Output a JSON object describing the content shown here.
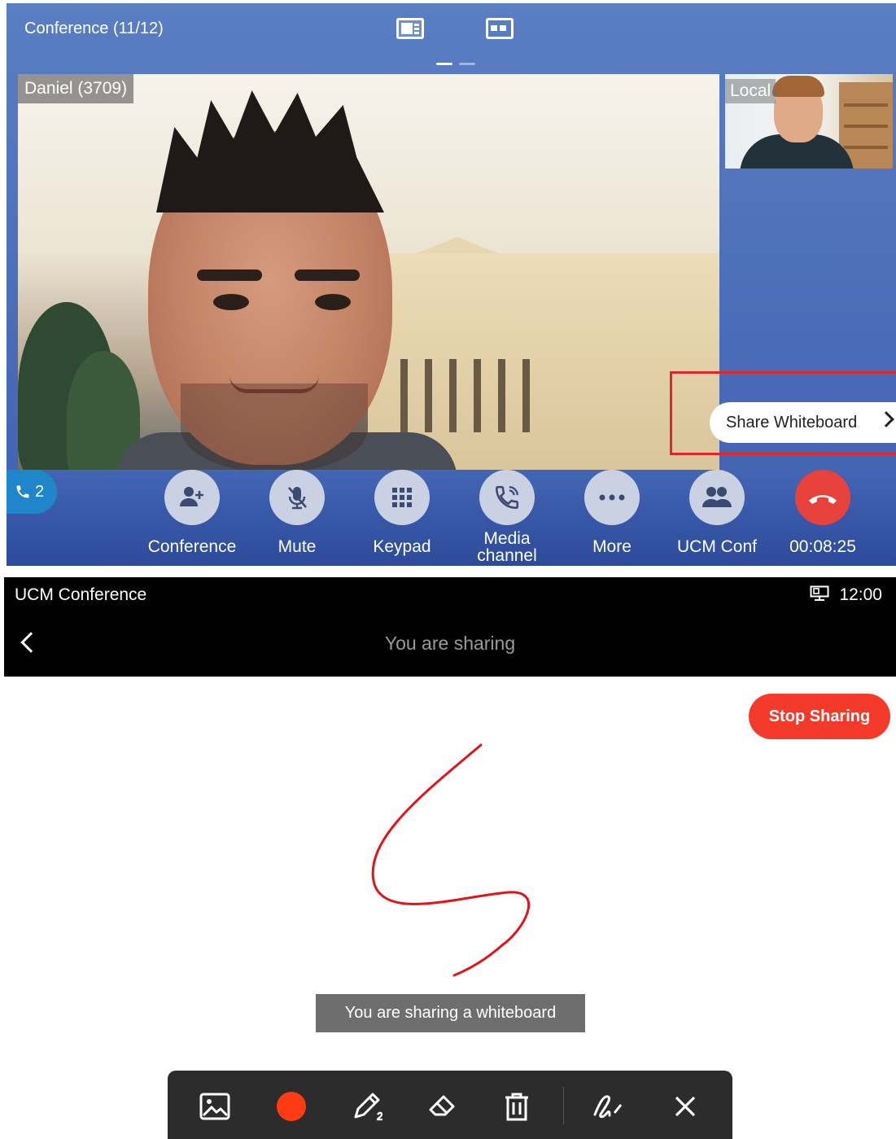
{
  "call": {
    "title": "Conference (11/12)",
    "remote_name": "Daniel (3709)",
    "local_label": "Local",
    "share_whiteboard_label": "Share Whiteboard",
    "active_calls": "2",
    "controls": [
      {
        "label": "Conference",
        "icon": "add-user-icon"
      },
      {
        "label": "Mute",
        "icon": "microphone-muted-icon"
      },
      {
        "label": "Keypad",
        "icon": "keypad-icon"
      },
      {
        "label_line1": "Media",
        "label_line2": "channel",
        "icon": "media-channel-icon"
      },
      {
        "label": "More",
        "icon": "more-icon"
      },
      {
        "label": "UCM Conf",
        "icon": "group-icon"
      },
      {
        "label": "00:08:25",
        "icon": "hang-up-icon"
      }
    ],
    "colors": {
      "accent": "#4a6cb8",
      "hangup": "#e8423d",
      "highlight": "#e0262b"
    }
  },
  "whiteboard": {
    "app_name": "UCM Conference",
    "time": "12:00",
    "header_title": "You are sharing",
    "stop_label": "Stop Sharing",
    "toast": "You are sharing a whiteboard",
    "tools": [
      "image-icon",
      "color-dot-icon",
      "pen-icon",
      "eraser-icon",
      "trash-icon",
      "signature-icon",
      "close-icon"
    ],
    "colors": {
      "stop": "#f43b2b",
      "ink": "#e0141b",
      "pen_color": "#ff3b14"
    }
  }
}
